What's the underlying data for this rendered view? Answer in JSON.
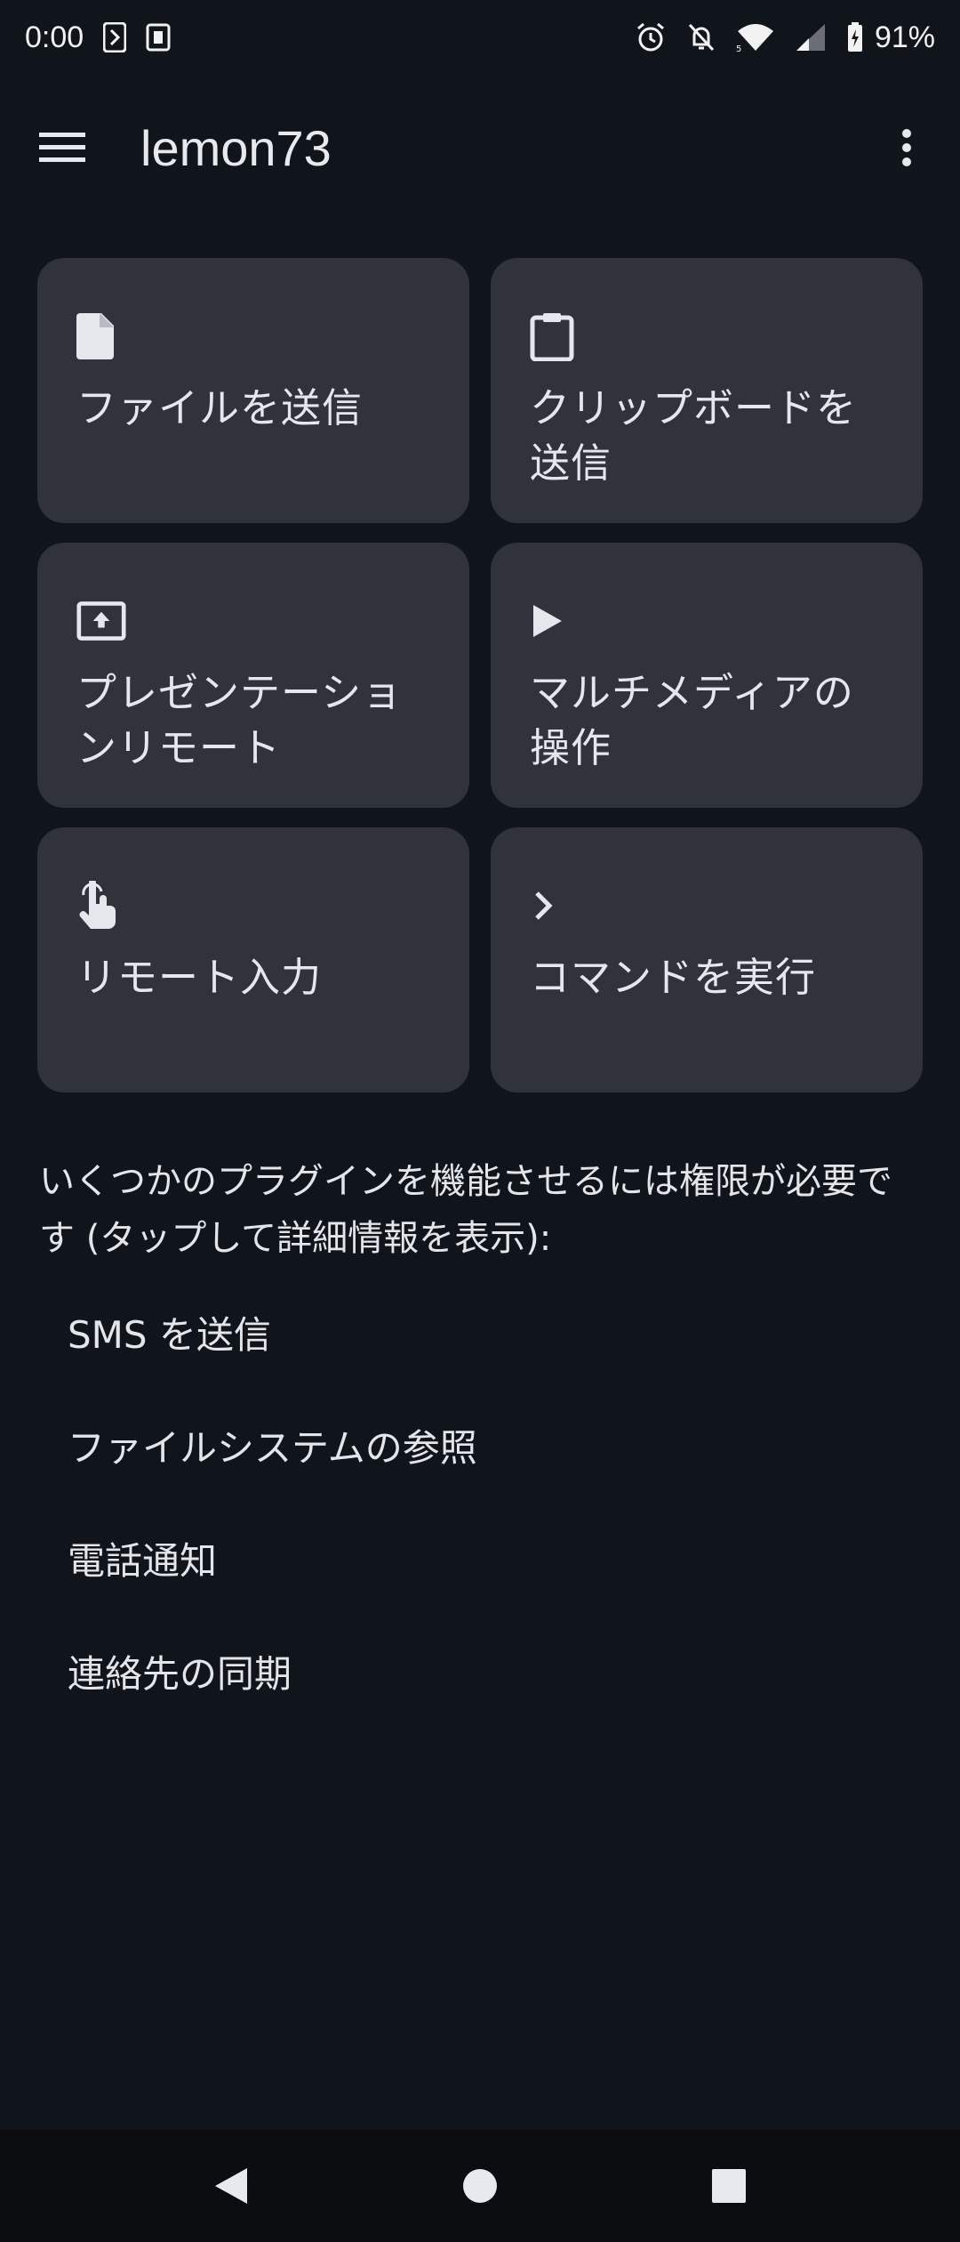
{
  "status_bar": {
    "time": "0:00",
    "battery_percent": "91%",
    "icons": [
      "notification-app-icon",
      "notification-app2-icon",
      "alarm-icon",
      "mute-icon",
      "wifi-icon",
      "signal-icon",
      "battery-charging-icon"
    ]
  },
  "app_bar": {
    "title": "lemon73",
    "menu_icon": "hamburger-menu-icon",
    "overflow_icon": "more-vert-icon"
  },
  "cards": [
    {
      "label": "ファイルを送信",
      "icon": "file-icon"
    },
    {
      "label": "クリップボードを送信",
      "icon": "clipboard-icon"
    },
    {
      "label": "プレゼンテーションリモート",
      "icon": "presentation-icon"
    },
    {
      "label": "マルチメディアの操作",
      "icon": "play-icon"
    },
    {
      "label": "リモート入力",
      "icon": "touch-icon"
    },
    {
      "label": "コマンドを実行",
      "icon": "chevron-right-icon"
    }
  ],
  "permissions": {
    "intro": "いくつかのプラグインを機能させるには権限が必要です (タップして詳細情報を表示):",
    "items": [
      "SMS を送信",
      "ファイルシステムの参照",
      "電話通知",
      "連絡先の同期"
    ]
  },
  "colors": {
    "background": "#10141b",
    "card": "#30333b",
    "text": "#e3e5ea",
    "nav_bar": "#0a0c10"
  }
}
